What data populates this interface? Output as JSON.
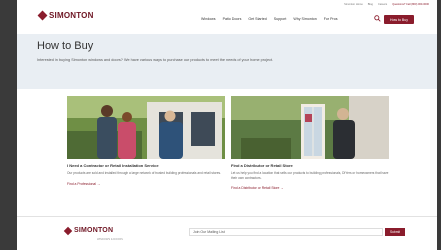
{
  "utility": {
    "link1": "Simonton Home",
    "link2": "Blog",
    "link3": "Careers",
    "phone": "Questions? Call (800) 000-0000"
  },
  "brand": {
    "name": "SIMONTON",
    "tagline": "WINDOWS & DOORS"
  },
  "nav": [
    "Windows",
    "Patio Doors",
    "Get Started",
    "Support",
    "Why Simonton",
    "For Pros"
  ],
  "header": {
    "cta": "How to Buy"
  },
  "hero": {
    "title": "How to Buy",
    "text": "Interested in buying Simonton windows and doors? We have various ways to purchase our products to meet the needs of your home project."
  },
  "cards": [
    {
      "title": "I Need a Contractor or Retail Installation Service",
      "desc": "Our products are sold and installed through a large network of trusted building professionals and retail stores.",
      "link": "Find a Professional →"
    },
    {
      "title": "Find a Distributor or Retail Store",
      "desc": "Let us help you find a location that sells our products to building professionals, DIYers or homeowners that have their own contractors.",
      "link": "Find a Distributor or Retail Store →"
    }
  ],
  "footer": {
    "mailing_label": "Join Our Mailing List",
    "submit": "Submit"
  },
  "colors": {
    "brand": "#8a1c2c",
    "hero_bg": "#e9eef3"
  }
}
